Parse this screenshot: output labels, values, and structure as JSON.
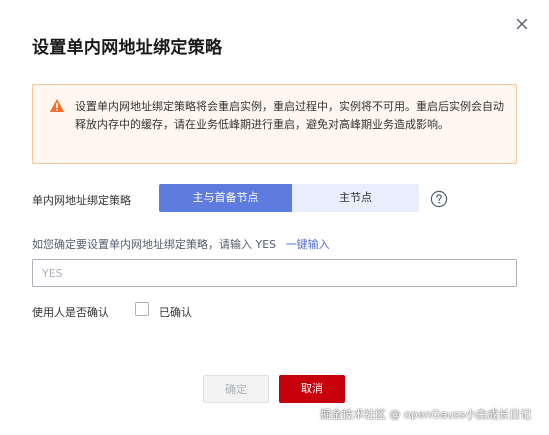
{
  "dialog": {
    "title": "设置单内网地址绑定策略",
    "close_icon": "close-icon"
  },
  "alert": {
    "icon": "warning-triangle-icon",
    "text": "设置单内网地址绑定策略将会重启实例，重启过程中，实例将不可用。重启后实例会自动释放内存中的缓存，请在业务低峰期进行重启，避免对高峰期业务造成影响。",
    "colors": {
      "background": "#fff7f0",
      "border": "#f6c39a",
      "icon": "#f66f2a"
    }
  },
  "policy": {
    "label": "单内网地址绑定策略",
    "options": [
      {
        "label": "主与首备节点",
        "selected": true
      },
      {
        "label": "主节点",
        "selected": false
      }
    ],
    "help_icon": "question-circle-icon",
    "colors": {
      "selected": "#5e7ce0",
      "unselected": "#e8eefc"
    }
  },
  "confirm": {
    "hint": "如您确定要设置单内网地址绑定策略，请输入 YES",
    "one_click_link": "一键输入",
    "input_value": "",
    "input_placeholder": "YES"
  },
  "user_confirm": {
    "label": "使用人是否确认",
    "checkbox_label": "已确认",
    "checked": false
  },
  "footer": {
    "ok_label": "确定",
    "ok_disabled": true,
    "cancel_label": "取消",
    "colors": {
      "cancel": "#c7000b"
    }
  },
  "watermark": "掘金技术社区 @ openGauss小白成长日记"
}
